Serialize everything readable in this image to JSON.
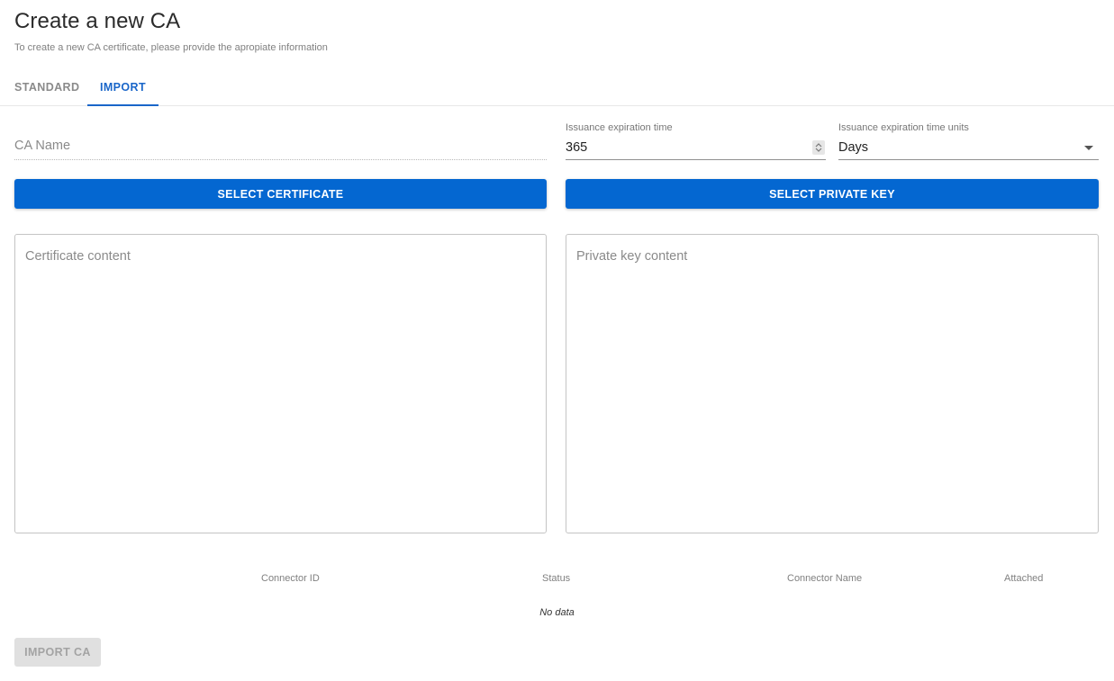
{
  "header": {
    "title": "Create a new CA",
    "subtitle": "To create a new CA certificate, please provide the apropiate information"
  },
  "tabs": [
    {
      "label": "STANDARD",
      "active": false
    },
    {
      "label": "IMPORT",
      "active": true
    }
  ],
  "form": {
    "ca_name": {
      "placeholder": "CA Name",
      "value": ""
    },
    "expiration_time": {
      "label": "Issuance expiration time",
      "value": "365"
    },
    "expiration_units": {
      "label": "Issuance expiration time units",
      "value": "Days"
    },
    "select_certificate_label": "SELECT CERTIFICATE",
    "select_private_key_label": "SELECT PRIVATE KEY",
    "certificate_content_placeholder": "Certificate content",
    "private_key_content_placeholder": "Private key content"
  },
  "table": {
    "columns": [
      "Connector ID",
      "Status",
      "Connector Name",
      "Attached"
    ],
    "empty_text": "No data"
  },
  "actions": {
    "import_label": "IMPORT CA",
    "import_disabled": true
  },
  "colors": {
    "primary": "#0467d1",
    "tab_active": "#1a66c9",
    "disabled_bg": "#e0e0e0"
  }
}
